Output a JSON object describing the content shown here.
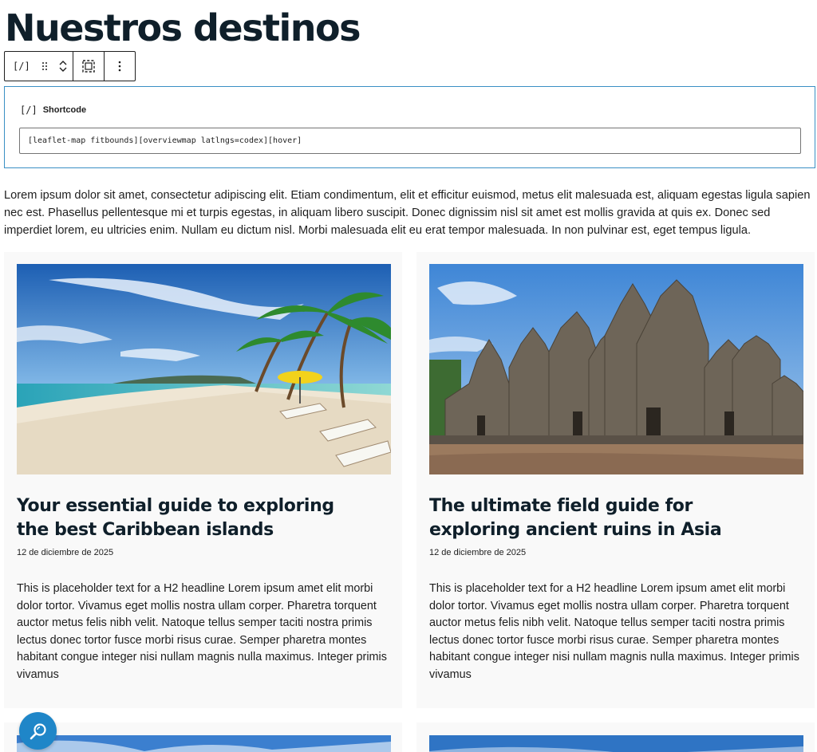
{
  "page": {
    "title": "Nuestros destinos"
  },
  "toolbar": {
    "block_type_icon": "[/]",
    "drag_icon": "drag-handle-icon",
    "move_up_icon": "chevron-up-icon",
    "move_down_icon": "chevron-down-icon",
    "select_parent_icon": "select-icon",
    "options_icon": "more-vertical-icon"
  },
  "shortcode": {
    "icon": "[/]",
    "label": "Shortcode",
    "value": "[leaflet-map fitbounds][overviewmap latlngs=codex][hover]"
  },
  "intro": {
    "text": "Lorem ipsum dolor sit amet, consectetur adipiscing elit. Etiam condimentum, elit et efficitur euismod, metus elit malesuada est, aliquam egestas ligula sapien nec est. Phasellus pellentesque mi et turpis egestas, in aliquam libero suscipit. Donec dignissim nisl sit amet est mollis gravida at quis ex. Donec sed imperdiet lorem, eu ultricies enim. Nullam eu dictum nisl. Morbi malesuada elit eu erat tempor malesuada. In non pulvinar est, eget tempus ligula."
  },
  "posts": [
    {
      "title": "Your essential guide to exploring the best Caribbean islands",
      "date": "12 de diciembre de 2025",
      "excerpt": "This is placeholder text for a H2 headline Lorem ipsum amet elit morbi dolor tortor. Vivamus eget mollis nostra ullam corper. Pharetra torquent auctor metus felis nibh velit. Natoque tellus semper taciti nostra primis lectus donec tortor fusce morbi risus curae. Semper pharetra montes habitant congue integer nisi nullam magnis nulla maximus. Integer primis vivamus"
    },
    {
      "title": "The ultimate field guide for exploring ancient ruins in Asia",
      "date": "12 de diciembre de 2025",
      "excerpt": "This is placeholder text for a H2 headline Lorem ipsum amet elit morbi dolor tortor. Vivamus eget mollis nostra ullam corper. Pharetra torquent auctor metus felis nibh velit. Natoque tellus semper taciti nostra primis lectus donec tortor fusce morbi risus curae. Semper pharetra montes habitant congue integer nisi nullam magnis nulla maximus. Integer primis vivamus"
    }
  ],
  "fab": {
    "icon": "search-zoom-icon"
  },
  "colors": {
    "accent": "#1f86c8",
    "selection_border": "#3a8fc4",
    "heading": "#0f1f2a",
    "card_bg": "#f9f9f9"
  }
}
